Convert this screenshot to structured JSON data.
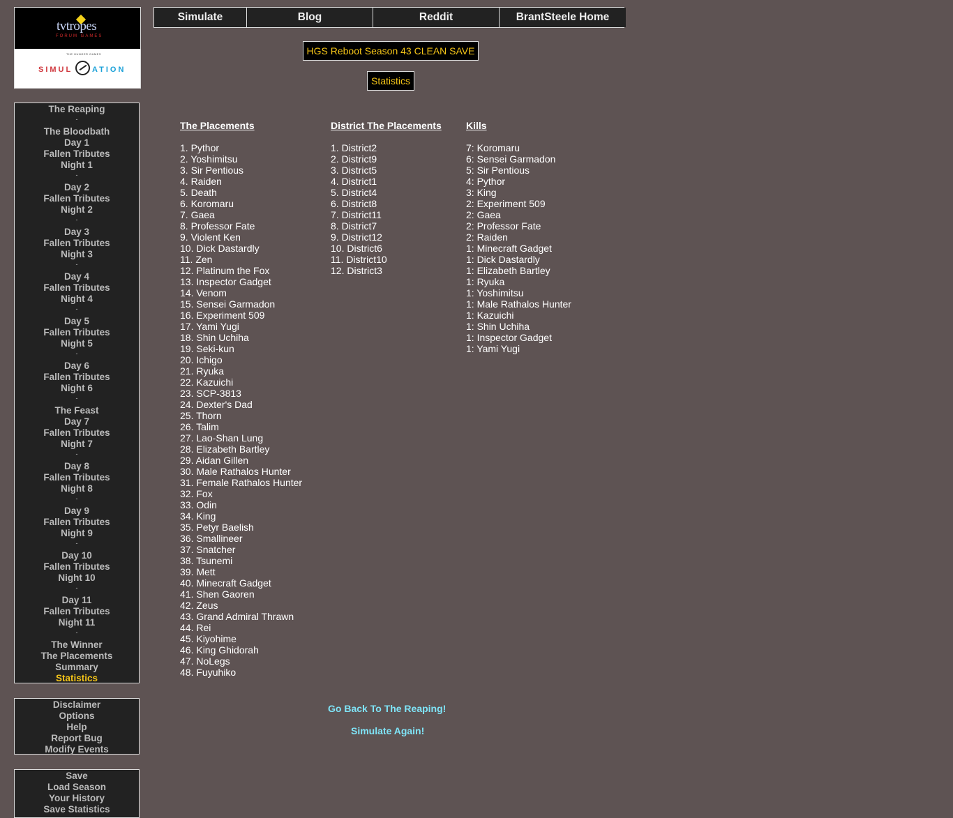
{
  "logo": {
    "line1": "tvtropes",
    "line2": "FORUM GAMES",
    "line3": "THE HUNGER GAMES",
    "simul": "SIMUL",
    "ation": "ATION"
  },
  "top_nav": [
    "Simulate",
    "Blog",
    "Reddit",
    "BrantSteele Home"
  ],
  "title": "HGS Reboot Season 43 CLEAN SAVE",
  "stats_label": "Statistics",
  "sidebar_nav": [
    {
      "label": "The Reaping"
    },
    {
      "sep": "-"
    },
    {
      "label": "The Bloodbath"
    },
    {
      "label": "Day 1"
    },
    {
      "label": "Fallen Tributes"
    },
    {
      "label": "Night 1"
    },
    {
      "sep": "-"
    },
    {
      "label": "Day 2"
    },
    {
      "label": "Fallen Tributes"
    },
    {
      "label": "Night 2"
    },
    {
      "sep": "-"
    },
    {
      "label": "Day 3"
    },
    {
      "label": "Fallen Tributes"
    },
    {
      "label": "Night 3"
    },
    {
      "sep": "-"
    },
    {
      "label": "Day 4"
    },
    {
      "label": "Fallen Tributes"
    },
    {
      "label": "Night 4"
    },
    {
      "sep": "-"
    },
    {
      "label": "Day 5"
    },
    {
      "label": "Fallen Tributes"
    },
    {
      "label": "Night 5"
    },
    {
      "sep": "-"
    },
    {
      "label": "Day 6"
    },
    {
      "label": "Fallen Tributes"
    },
    {
      "label": "Night 6"
    },
    {
      "sep": "-"
    },
    {
      "label": "The Feast"
    },
    {
      "label": "Day 7"
    },
    {
      "label": "Fallen Tributes"
    },
    {
      "label": "Night 7"
    },
    {
      "sep": "-"
    },
    {
      "label": "Day 8"
    },
    {
      "label": "Fallen Tributes"
    },
    {
      "label": "Night 8"
    },
    {
      "sep": "-"
    },
    {
      "label": "Day 9"
    },
    {
      "label": "Fallen Tributes"
    },
    {
      "label": "Night 9"
    },
    {
      "sep": "-"
    },
    {
      "label": "Day 10"
    },
    {
      "label": "Fallen Tributes"
    },
    {
      "label": "Night 10"
    },
    {
      "sep": "-"
    },
    {
      "label": "Day 11"
    },
    {
      "label": "Fallen Tributes"
    },
    {
      "label": "Night 11"
    },
    {
      "sep": "-"
    },
    {
      "label": "The Winner"
    },
    {
      "label": "The Placements"
    },
    {
      "label": "Summary"
    },
    {
      "label": "Statistics",
      "active": true
    }
  ],
  "sidebar_misc": [
    "Disclaimer",
    "Options",
    "Help",
    "Report Bug",
    "Modify Events"
  ],
  "sidebar_save": [
    "Save",
    "Load Season",
    "Your History",
    "Save Statistics"
  ],
  "placements": {
    "heading": "The Placements",
    "items": [
      "1. Pythor",
      "2. Yoshimitsu",
      "3. Sir Pentious",
      "4. Raiden",
      "5. Death",
      "6. Koromaru",
      "7. Gaea",
      "8. Professor Fate",
      "9. Violent Ken",
      "10. Dick Dastardly",
      "11. Zen",
      "12. Platinum the Fox",
      "13. Inspector Gadget",
      "14. Venom",
      "15. Sensei Garmadon",
      "16. Experiment 509",
      "17. Yami Yugi",
      "18. Shin Uchiha",
      "19. Seki-kun",
      "20. Ichigo",
      "21. Ryuka",
      "22. Kazuichi",
      "23. SCP-3813",
      "24. Dexter's Dad",
      "25. Thorn",
      "26. Talim",
      "27. Lao-Shan Lung",
      "28. Elizabeth Bartley",
      "29. Aidan Gillen",
      "30. Male Rathalos Hunter",
      "31. Female Rathalos Hunter",
      "32. Fox",
      "33. Odin",
      "34. King",
      "35. Petyr Baelish",
      "36. Smallineer",
      "37. Snatcher",
      "38. Tsunemi",
      "39. Mett",
      "40. Minecraft Gadget",
      "41. Shen Gaoren",
      "42. Zeus",
      "43. Grand Admiral Thrawn",
      "44. Rei",
      "45. Kiyohime",
      "46. King Ghidorah",
      "47. NoLegs",
      "48. Fuyuhiko"
    ]
  },
  "district_placements": {
    "heading": "District The Placements",
    "items": [
      "1. District2",
      "2. District9",
      "3. District5",
      "4. District1",
      "5. District4",
      "6. District8",
      "7. District11",
      "8. District7",
      "9. District12",
      "10. District6",
      "11. District10",
      "12. District3"
    ]
  },
  "kills": {
    "heading": "Kills",
    "items": [
      "7: Koromaru",
      "6: Sensei Garmadon",
      "5: Sir Pentious",
      "4: Pythor",
      "3: King",
      "2: Experiment 509",
      "2: Gaea",
      "2: Professor Fate",
      "2: Raiden",
      "1: Minecraft Gadget",
      "1: Dick Dastardly",
      "1: Elizabeth Bartley",
      "1: Ryuka",
      "1: Yoshimitsu",
      "1: Male Rathalos Hunter",
      "1: Kazuichi",
      "1: Shin Uchiha",
      "1: Inspector Gadget",
      "1: Yami Yugi"
    ]
  },
  "bottom_links": {
    "go_back": "Go Back To The Reaping!",
    "simulate_again": "Simulate Again!"
  },
  "colors": {
    "background": "#5e5353",
    "panel": "#222222",
    "accent": "#f5c518",
    "link": "#7fe4f7"
  }
}
